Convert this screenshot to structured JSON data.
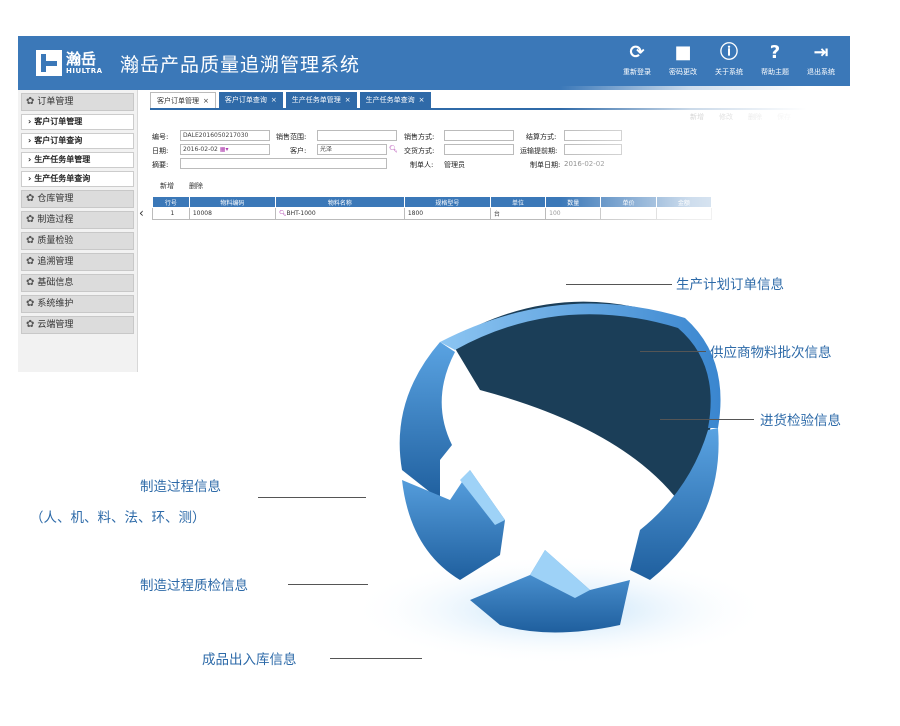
{
  "app": {
    "logo_cn": "瀚岳",
    "logo_en": "HIULTRA",
    "title": "瀚岳产品质量追溯管理系统",
    "actions": [
      {
        "icon": "refresh-icon",
        "label": "重新登录"
      },
      {
        "icon": "lock-icon",
        "label": "密码更改"
      },
      {
        "icon": "info-icon",
        "label": "关于系统"
      },
      {
        "icon": "help-icon",
        "label": "帮助主题"
      },
      {
        "icon": "exit-icon",
        "label": "退出系统"
      }
    ],
    "sidebar": {
      "order_group": "订单管理",
      "order_items": [
        "客户订单管理",
        "客户订单查询",
        "生产任务单管理",
        "生产任务单查询"
      ],
      "groups": [
        "仓库管理",
        "制造过程",
        "质量检验",
        "追溯管理",
        "基础信息",
        "系统维护",
        "云端管理"
      ]
    },
    "tabs": [
      {
        "label": "客户订单管理",
        "active": true
      },
      {
        "label": "客户订单查询",
        "active": false
      },
      {
        "label": "生产任务单管理",
        "active": false
      },
      {
        "label": "生产任务单查询",
        "active": false
      }
    ],
    "toolbar_right": [
      "新增",
      "修改",
      "删除",
      "保存"
    ],
    "form": {
      "no_label": "编号:",
      "no_value": "DALE2016050217030",
      "sales_range_label": "销售范围:",
      "sales_method_label": "销售方式:",
      "settle_label": "结算方式:",
      "date_label": "日期:",
      "date_value": "2016-02-02",
      "customer_label": "客户:",
      "customer_value": "光泽",
      "delivery_label": "交货方式:",
      "ship_date_label": "运输提前期:",
      "remark_label": "摘要:",
      "maker_label": "制单人:",
      "maker_value": "管理员",
      "make_date_label": "制单日期:",
      "make_date_value": "2016-02-02"
    },
    "grid_tools": [
      "新增",
      "删除"
    ],
    "grid": {
      "headers": [
        "行号",
        "物料编码",
        "物料名称",
        "规格型号",
        "单位",
        "数量",
        "单价",
        "金额"
      ],
      "rows": [
        [
          "1",
          "10008",
          "BHT-1000",
          "1800",
          "台",
          "100",
          "",
          ""
        ]
      ]
    }
  },
  "diagram": {
    "labels": {
      "plan": "生产计划订单信息",
      "supplier": "供应商物料批次信息",
      "incoming": "进货检验信息",
      "process": "制造过程信息",
      "process_sub": "（人、机、料、法、环、测）",
      "process_qc": "制造过程质检信息",
      "finished": "成品出入库信息"
    },
    "colors": {
      "ring_front": "#3a86cf",
      "ring_inner": "#1b3e58",
      "label": "#2d6aa8"
    }
  }
}
